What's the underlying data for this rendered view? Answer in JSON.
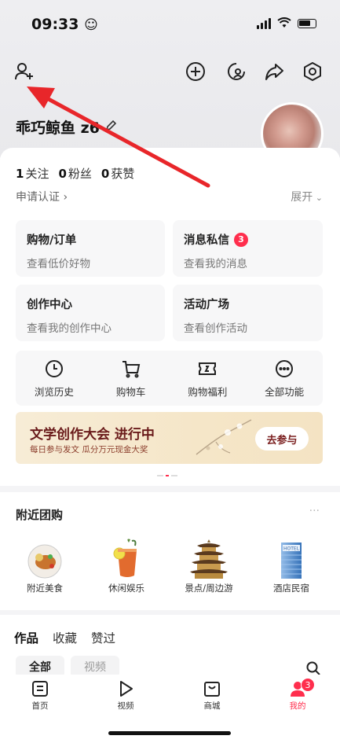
{
  "status": {
    "time": "09:33"
  },
  "profile": {
    "name": "乖巧鲸鱼 z6"
  },
  "stats": {
    "following_count": "1",
    "following_label": "关注",
    "followers_count": "0",
    "followers_label": "粉丝",
    "likes_count": "0",
    "likes_label": "获赞"
  },
  "cert_label": "申请认证",
  "expand_label": "展开",
  "cards": [
    {
      "title": "购物/订单",
      "subtitle": "查看低价好物"
    },
    {
      "title": "消息私信",
      "subtitle": "查看我的消息",
      "badge": "3"
    },
    {
      "title": "创作中心",
      "subtitle": "查看我的创作中心"
    },
    {
      "title": "活动广场",
      "subtitle": "查看创作活动"
    }
  ],
  "tools": [
    {
      "label": "浏览历史",
      "icon": "clock-icon"
    },
    {
      "label": "购物车",
      "icon": "cart-icon"
    },
    {
      "label": "购物福利",
      "icon": "coupon-icon"
    },
    {
      "label": "全部功能",
      "icon": "more-dots-icon"
    }
  ],
  "banner": {
    "title": "文学创作大会 进行中",
    "subtitle": "每日参与发文 瓜分万元现金大奖",
    "button": "去参与"
  },
  "group": {
    "title": "附近团购",
    "more": "···",
    "items": [
      {
        "label": "附近美食"
      },
      {
        "label": "休闲娱乐"
      },
      {
        "label": "景点/周边游"
      },
      {
        "label": "酒店民宿"
      }
    ]
  },
  "works": {
    "tabs": [
      "作品",
      "收藏",
      "赞过"
    ],
    "chips": [
      "全部",
      "视频"
    ]
  },
  "tabbar": {
    "items": [
      {
        "label": "首页"
      },
      {
        "label": "视频"
      },
      {
        "label": "商城"
      },
      {
        "label": "我的",
        "badge": "3"
      }
    ]
  },
  "colors": {
    "accent": "#ff2e4d",
    "annotation_arrow": "#e8262a"
  }
}
